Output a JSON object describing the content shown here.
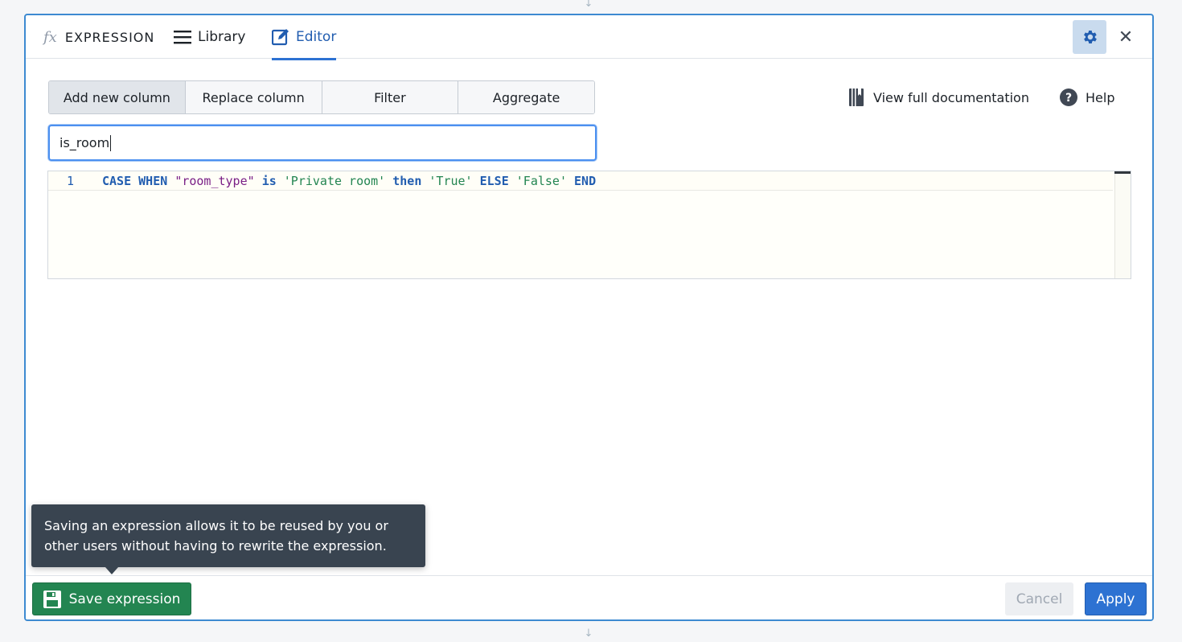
{
  "header": {
    "title": "EXPRESSION",
    "tabs": [
      {
        "label": "Library",
        "icon": "list-icon"
      },
      {
        "label": "Editor",
        "icon": "edit-icon",
        "active": true
      }
    ]
  },
  "modes": [
    {
      "label": "Add new column",
      "active": true
    },
    {
      "label": "Replace column"
    },
    {
      "label": "Filter"
    },
    {
      "label": "Aggregate"
    }
  ],
  "links": {
    "documentation": "View full documentation",
    "help": "Help"
  },
  "column_name": {
    "value": "is_room"
  },
  "code": {
    "line_number": "1",
    "tokens": {
      "case": "CASE",
      "when": "WHEN",
      "col": "\"room_type\"",
      "is": "is",
      "val1": "'Private room'",
      "then": "then",
      "t": "'True'",
      "else": "ELSE",
      "f": "'False'",
      "end": "END"
    }
  },
  "tooltip": {
    "line1": "Saving an expression allows it to be reused by you or",
    "line2": "other users without having to rewrite the expression."
  },
  "footer": {
    "save": "Save expression",
    "cancel": "Cancel",
    "apply": "Apply"
  },
  "colors": {
    "accent": "#2d72d2",
    "save_green": "#238551",
    "keyword": "#215db0",
    "string_green": "#238551",
    "string_purple": "#7a1f86"
  }
}
